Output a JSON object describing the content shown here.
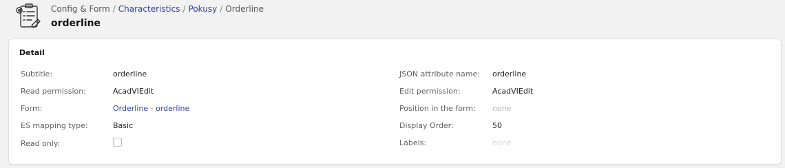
{
  "breadcrumb": {
    "root": "Config & Form",
    "items": [
      "Characteristics",
      "Pokusy"
    ],
    "current": "Orderline",
    "separator": "/"
  },
  "page": {
    "title": "orderline"
  },
  "detail": {
    "title": "Detail",
    "left": [
      {
        "label": "Subtitle:",
        "value": "orderline"
      },
      {
        "label": "Read permission:",
        "value": "AcadVIEdit"
      },
      {
        "label": "Form:",
        "value": "Orderline - orderline"
      },
      {
        "label": "ES mapping type:",
        "value": "Basic"
      },
      {
        "label": "Read only:",
        "checked": false
      }
    ],
    "right": [
      {
        "label": "JSON attribute name:",
        "value": "orderline"
      },
      {
        "label": "Edit permission:",
        "value": "AcadVIEdit"
      },
      {
        "label": "Position in the form:",
        "value": "none"
      },
      {
        "label": "Display Order:",
        "value": "50"
      },
      {
        "label": "Labels:",
        "value": "none"
      }
    ]
  },
  "colors": {
    "link": "#2f3fa8",
    "muted": "#b8b8b8",
    "background": "#f2f2f2"
  },
  "icons": {
    "app": "form-settings-icon"
  }
}
